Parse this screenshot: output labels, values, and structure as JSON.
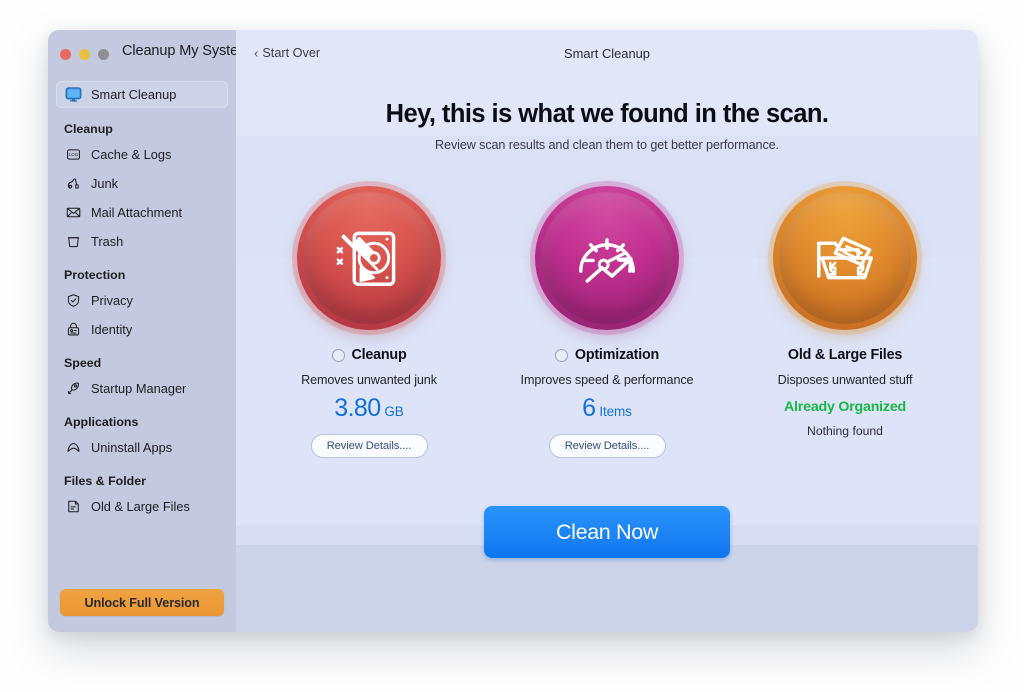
{
  "window": {
    "app_title": "Cleanup My System",
    "traffic_lights": [
      {
        "name": "close-button",
        "color": "#e8695f"
      },
      {
        "name": "minimize-button",
        "color": "#e9c140"
      },
      {
        "name": "zoom-button",
        "color": "#8e8e93"
      }
    ]
  },
  "sidebar": {
    "selected": {
      "label": "Smart Cleanup",
      "icon": "monitor-icon"
    },
    "groups": [
      {
        "title": "Cleanup",
        "items": [
          {
            "label": "Cache & Logs",
            "icon": "log-file-icon"
          },
          {
            "label": "Junk",
            "icon": "vacuum-icon"
          },
          {
            "label": "Mail Attachment",
            "icon": "envelope-icon"
          },
          {
            "label": "Trash",
            "icon": "trash-icon"
          }
        ]
      },
      {
        "title": "Protection",
        "items": [
          {
            "label": "Privacy",
            "icon": "shield-check-icon"
          },
          {
            "label": "Identity",
            "icon": "id-lock-icon"
          }
        ]
      },
      {
        "title": "Speed",
        "items": [
          {
            "label": "Startup Manager",
            "icon": "rocket-icon"
          }
        ]
      },
      {
        "title": "Applications",
        "items": [
          {
            "label": "Uninstall Apps",
            "icon": "chevron-up-outline-icon"
          }
        ]
      },
      {
        "title": "Files & Folder",
        "items": [
          {
            "label": "Old & Large Files",
            "icon": "document-icon"
          }
        ]
      }
    ],
    "unlock_label": "Unlock Full Version",
    "unlock_color": "#eb9633"
  },
  "topbar": {
    "back_label": "Start Over",
    "back_icon": "chevron-left-icon",
    "screen_title": "Smart Cleanup"
  },
  "hero": {
    "headline": "Hey, this is what we found in the scan.",
    "subline": "Review scan results and clean them to get better performance."
  },
  "cards": [
    {
      "name": "cleanup",
      "icon": "disk-broom-icon",
      "badge_color": "#c4434a",
      "has_radio": true,
      "title": "Cleanup",
      "description": "Removes unwanted junk",
      "metric_value": "3.80",
      "metric_unit": "GB",
      "metric_color": "#1471d8",
      "action_label": "Review Details...."
    },
    {
      "name": "optimization",
      "icon": "speedometer-arrow-icon",
      "badge_color": "#b9308b",
      "has_radio": true,
      "title": "Optimization",
      "description": "Improves speed & performance",
      "metric_value": "6",
      "metric_unit": "Items",
      "metric_color": "#1471d8",
      "action_label": "Review Details...."
    },
    {
      "name": "old-large-files",
      "icon": "folder-resize-icon",
      "badge_color": "#dd8a2c",
      "has_radio": false,
      "title": "Old & Large Files",
      "description": "Disposes unwanted stuff",
      "status": "Already Organized",
      "status_color": "#1ab547",
      "status_sub": "Nothing found"
    }
  ],
  "footer": {
    "clean_label": "Clean Now",
    "clean_color": "#0f77ef"
  }
}
